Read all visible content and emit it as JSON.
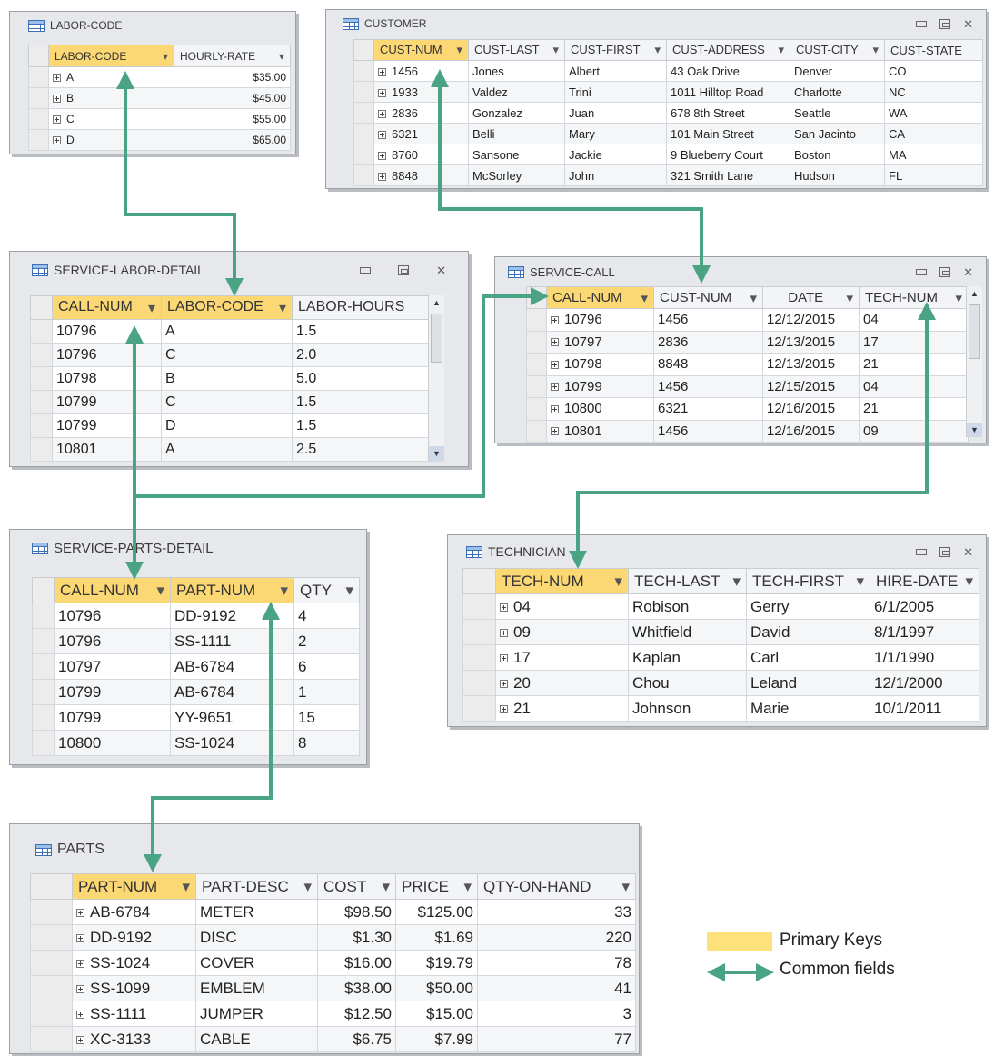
{
  "colors": {
    "primary_key": "#fbd873",
    "link_line": "#4aa383",
    "window_bg": "#e6e8eb"
  },
  "tables": {
    "labor_code": {
      "title": "LABOR-CODE",
      "headers": [
        "LABOR-CODE",
        "HOURLY-RATE"
      ],
      "rows": [
        [
          "A",
          "$35.00"
        ],
        [
          "B",
          "$45.00"
        ],
        [
          "C",
          "$55.00"
        ],
        [
          "D",
          "$65.00"
        ]
      ]
    },
    "customer": {
      "title": "CUSTOMER",
      "headers": [
        "CUST-NUM",
        "CUST-LAST",
        "CUST-FIRST",
        "CUST-ADDRESS",
        "CUST-CITY",
        "CUST-STATE"
      ],
      "rows": [
        [
          "1456",
          "Jones",
          "Albert",
          "43 Oak Drive",
          "Denver",
          "CO"
        ],
        [
          "1933",
          "Valdez",
          "Trini",
          "1011 Hilltop Road",
          "Charlotte",
          "NC"
        ],
        [
          "2836",
          "Gonzalez",
          "Juan",
          "678 8th Street",
          "Seattle",
          "WA"
        ],
        [
          "6321",
          "Belli",
          "Mary",
          "101 Main Street",
          "San Jacinto",
          "CA"
        ],
        [
          "8760",
          "Sansone",
          "Jackie",
          "9 Blueberry Court",
          "Boston",
          "MA"
        ],
        [
          "8848",
          "McSorley",
          "John",
          "321 Smith Lane",
          "Hudson",
          "FL"
        ]
      ]
    },
    "service_labor_detail": {
      "title": "SERVICE-LABOR-DETAIL",
      "headers": [
        "CALL-NUM",
        "LABOR-CODE",
        "LABOR-HOURS"
      ],
      "rows": [
        [
          "10796",
          "A",
          "1.5"
        ],
        [
          "10796",
          "C",
          "2.0"
        ],
        [
          "10798",
          "B",
          "5.0"
        ],
        [
          "10799",
          "C",
          "1.5"
        ],
        [
          "10799",
          "D",
          "1.5"
        ],
        [
          "10801",
          "A",
          "2.5"
        ]
      ]
    },
    "service_call": {
      "title": "SERVICE-CALL",
      "headers": [
        "CALL-NUM",
        "CUST-NUM",
        "DATE",
        "TECH-NUM"
      ],
      "rows": [
        [
          "10796",
          "1456",
          "12/12/2015",
          "04"
        ],
        [
          "10797",
          "2836",
          "12/13/2015",
          "17"
        ],
        [
          "10798",
          "8848",
          "12/13/2015",
          "21"
        ],
        [
          "10799",
          "1456",
          "12/15/2015",
          "04"
        ],
        [
          "10800",
          "6321",
          "12/16/2015",
          "21"
        ],
        [
          "10801",
          "1456",
          "12/16/2015",
          "09"
        ]
      ]
    },
    "service_parts_detail": {
      "title": "SERVICE-PARTS-DETAIL",
      "headers": [
        "CALL-NUM",
        "PART-NUM",
        "QTY"
      ],
      "rows": [
        [
          "10796",
          "DD-9192",
          "4"
        ],
        [
          "10796",
          "SS-1111",
          "2"
        ],
        [
          "10797",
          "AB-6784",
          "6"
        ],
        [
          "10799",
          "AB-6784",
          "1"
        ],
        [
          "10799",
          "YY-9651",
          "15"
        ],
        [
          "10800",
          "SS-1024",
          "8"
        ]
      ]
    },
    "technician": {
      "title": "TECHNICIAN",
      "headers": [
        "TECH-NUM",
        "TECH-LAST",
        "TECH-FIRST",
        "HIRE-DATE"
      ],
      "rows": [
        [
          "04",
          "Robison",
          "Gerry",
          "6/1/2005"
        ],
        [
          "09",
          "Whitfield",
          "David",
          "8/1/1997"
        ],
        [
          "17",
          "Kaplan",
          "Carl",
          "1/1/1990"
        ],
        [
          "20",
          "Chou",
          "Leland",
          "12/1/2000"
        ],
        [
          "21",
          "Johnson",
          "Marie",
          "10/1/2011"
        ]
      ]
    },
    "parts": {
      "title": "PARTS",
      "headers": [
        "PART-NUM",
        "PART-DESC",
        "COST",
        "PRICE",
        "QTY-ON-HAND"
      ],
      "rows": [
        [
          "AB-6784",
          "METER",
          "$98.50",
          "$125.00",
          "33"
        ],
        [
          "DD-9192",
          "DISC",
          "$1.30",
          "$1.69",
          "220"
        ],
        [
          "SS-1024",
          "COVER",
          "$16.00",
          "$19.79",
          "78"
        ],
        [
          "SS-1099",
          "EMBLEM",
          "$38.00",
          "$50.00",
          "41"
        ],
        [
          "SS-1111",
          "JUMPER",
          "$12.50",
          "$15.00",
          "3"
        ],
        [
          "XC-3133",
          "CABLE",
          "$6.75",
          "$7.99",
          "77"
        ]
      ]
    }
  },
  "legend": {
    "primary_keys_label": "Primary Keys",
    "common_fields_label": "Common fields"
  }
}
